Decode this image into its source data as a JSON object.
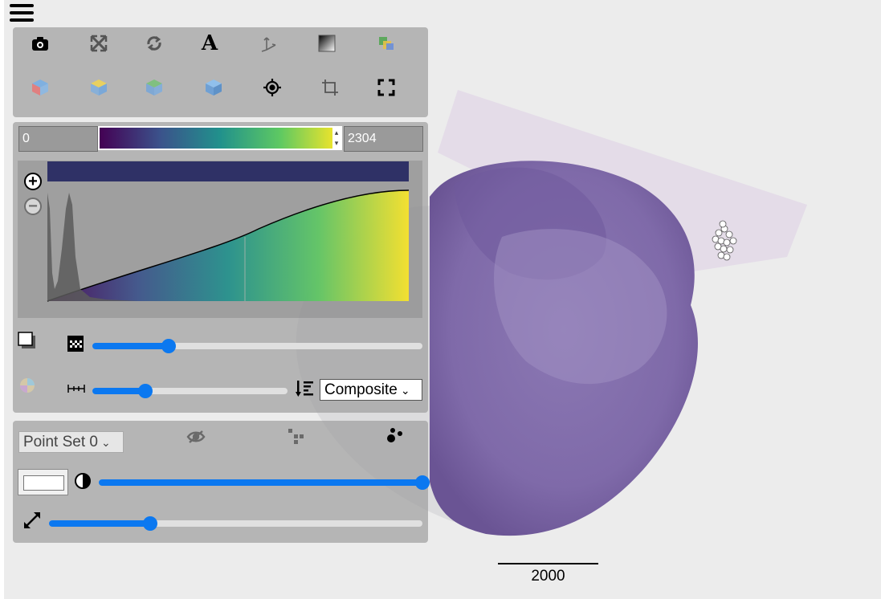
{
  "menu": {
    "icon": "hamburger-menu-icon"
  },
  "toolbar": {
    "row1": [
      "camera-icon",
      "expand-arrows-icon",
      "rotate-icon",
      "annotation-text-icon",
      "axes-icon",
      "gradient-opacity-icon",
      "planes-icon"
    ],
    "row2": [
      "view-x-icon",
      "view-y-icon",
      "view-z-icon",
      "view-3d-icon",
      "reset-camera-icon",
      "crop-icon",
      "fullscreen-icon"
    ]
  },
  "colormap": {
    "min": "0",
    "max": "2304",
    "name_icon": "viridis-colormap",
    "colors": [
      "#440154",
      "#3b528b",
      "#21918c",
      "#5ec962",
      "#fde725"
    ]
  },
  "volume": {
    "opacity_slider": 0.23,
    "sample_distance_slider": 0.27,
    "blend_mode": "Composite"
  },
  "point_set": {
    "selected": "Point Set 0",
    "color": "#ffffff",
    "opacity_slider": 1.0,
    "size_slider": 0.27
  },
  "scale_bar": {
    "label": "2000"
  }
}
